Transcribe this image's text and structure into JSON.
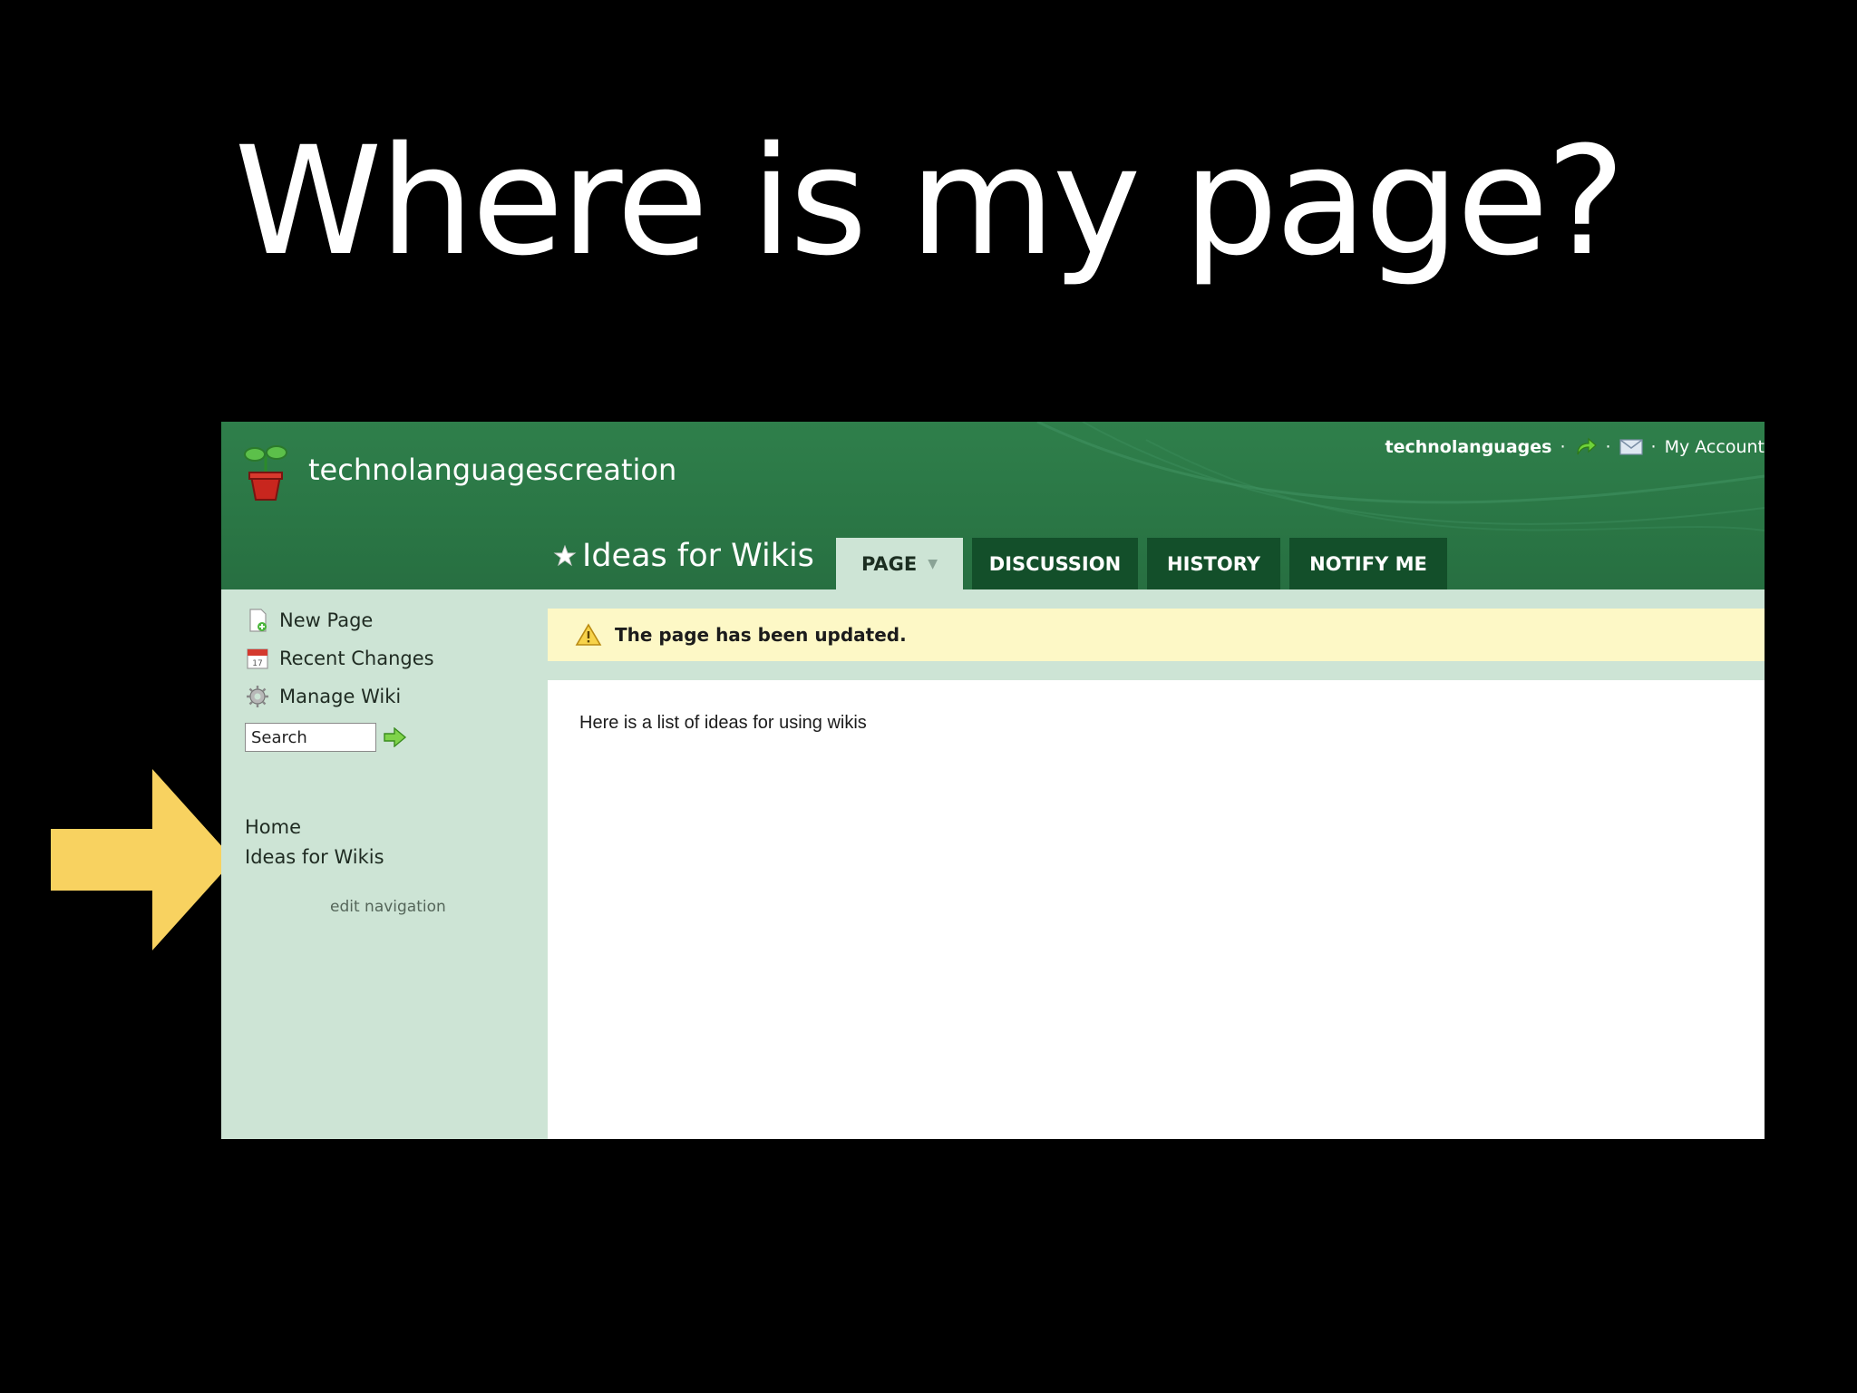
{
  "slide": {
    "title": "Where is my page?",
    "arrow_color": "#f8d260"
  },
  "wiki": {
    "name": "technolanguagescreation",
    "header_color": "#2a7645",
    "topbar": {
      "username": "technolanguages",
      "my_account": "My Account"
    },
    "page_title": "Ideas for Wikis",
    "tabs": [
      {
        "label": "PAGE",
        "active": true
      },
      {
        "label": "DISCUSSION",
        "active": false
      },
      {
        "label": "HISTORY",
        "active": false
      },
      {
        "label": "NOTIFY ME",
        "active": false
      }
    ],
    "sidebar": {
      "new_page": "New Page",
      "recent_changes": "Recent Changes",
      "manage_wiki": "Manage Wiki",
      "search_placeholder": "Search",
      "nav_items": [
        "Home",
        "Ideas for Wikis"
      ],
      "edit_navigation": "edit navigation"
    },
    "notice": "The page has been updated.",
    "content_text": "Here is a list of ideas for using wikis"
  }
}
